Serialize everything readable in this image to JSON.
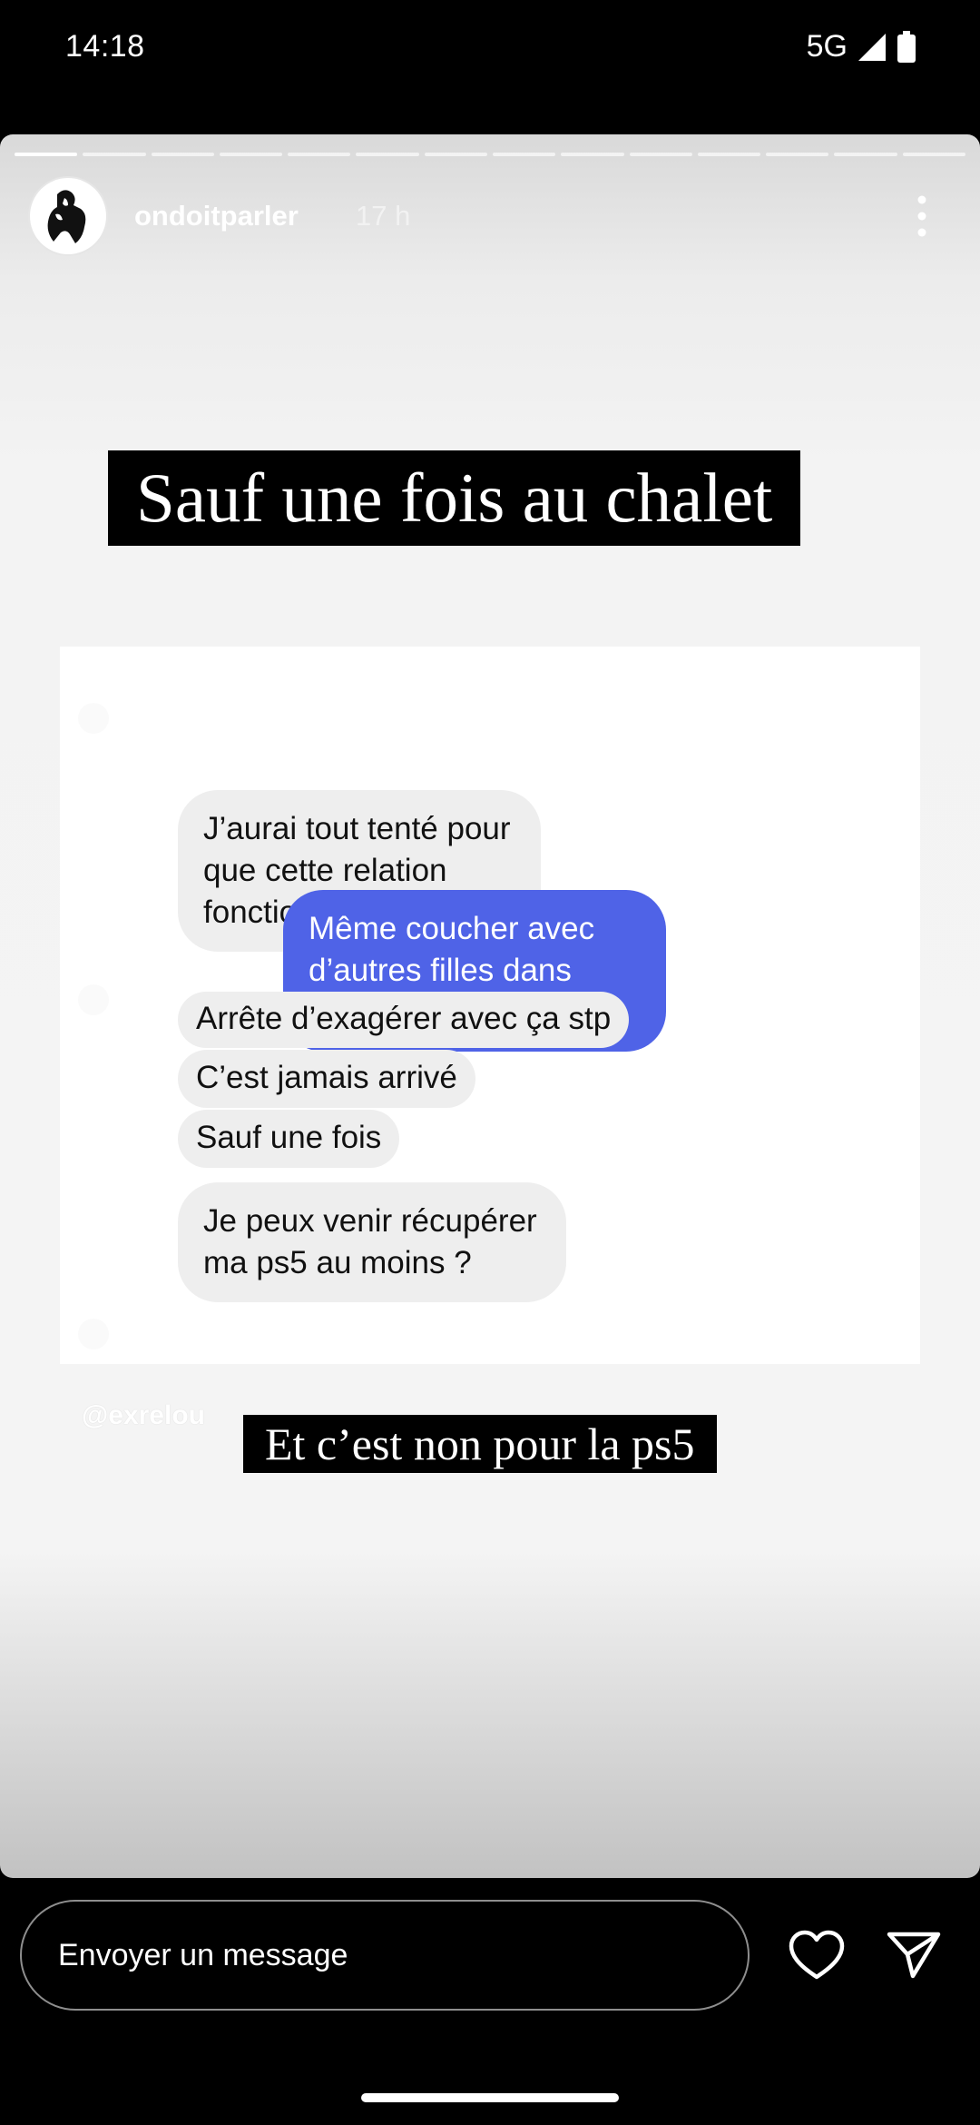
{
  "status_bar": {
    "time": "14:18",
    "network": "5G"
  },
  "story": {
    "segments": 14,
    "active_segment": 0,
    "username": "ondoitparler",
    "time_ago": "17 h",
    "caption_top": "Sauf une fois au chalet",
    "caption_bottom": "Et c’est non pour la ps5",
    "watermark": "@exrelou",
    "chat": {
      "messages": [
        {
          "side": "in",
          "text": "J’aurai tout tenté pour que cette relation fonctionne…"
        },
        {
          "side": "out",
          "text": "Même coucher avec d’autres filles dans mon dos 😉"
        },
        {
          "side": "in",
          "text": "Arrête d’exagérer avec ça stp"
        },
        {
          "side": "in",
          "text": "C’est jamais arrivé"
        },
        {
          "side": "in",
          "text": "Sauf une fois"
        },
        {
          "side": "in",
          "text": "Je peux venir récupérer ma ps5 au moins ?"
        }
      ]
    }
  },
  "reply_bar": {
    "placeholder": "Envoyer un message"
  },
  "colors": {
    "outgoing_bubble": "#4f63e7",
    "incoming_bubble": "#eeeeee"
  }
}
